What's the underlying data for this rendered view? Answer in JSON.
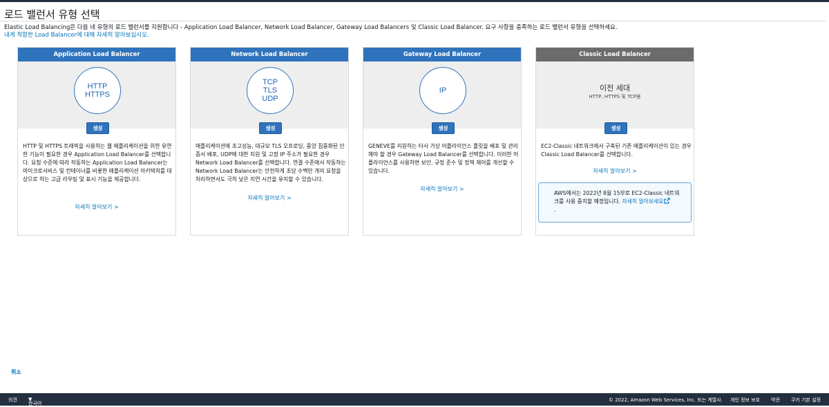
{
  "page": {
    "title": "로드 밸런서 유형 선택",
    "intro_line1": "Elastic Load Balancing은 다음 네 유형의 로드 밸런서를 지원합니다 - Application Load Balancer, Network Load Balancer, Gateway Load Balancers 및 Classic Load Balancer. 요구 사항을 충족하는 로드 밸런서 유형을 선택하세요.",
    "intro_link": "내게 적합한 Load Balancer에 대해 자세히 알아보십시오."
  },
  "cards": [
    {
      "header": "Application Load Balancer",
      "protocol_lines": [
        "HTTP",
        "HTTPS"
      ],
      "create_label": "생성",
      "description": "HTTP 및 HTTPS 트래픽을 사용하는 웹 애플리케이션을 위한 유연한 기능이 필요한 경우 Application Load Balancer를 선택합니다. 요청 수준에 따라 작동하는 Application Load Balancer는 마이크로서비스 및 컨테이너를 비롯한 애플리케이션 아키텍처를 대상으로 하는 고급 라우팅 및 표시 기능을 제공합니다.",
      "learn_more": "자세히 알아보기 >"
    },
    {
      "header": "Network Load Balancer",
      "protocol_lines": [
        "TCP",
        "TLS",
        "UDP"
      ],
      "create_label": "생성",
      "description": "애플리케이션에 초고성능, 대규모 TLS 오프로딩, 중앙 집중화된 인증서 배포, UDP에 대한 지원 및 고정 IP 주소가 필요한 경우 Network Load Balancer를 선택합니다. 연결 수준에서 작동하는 Network Load Balancer는 안전하게 초당 수백만 개의 요청을 처리하면서도 극히 낮은 지연 시간을 유지할 수 있습니다.",
      "learn_more": "자세히 알아보기 >"
    },
    {
      "header": "Gateway Load Balancer",
      "protocol_lines": [
        "IP"
      ],
      "create_label": "생성",
      "description": "GENEVE를 지원하는 타사 가상 어플라이언스 플릿을 배포 및 관리해야 할 경우 Gateway Load Balancer를 선택합니다. 이러한 어플라이언스를 사용하면 보안, 규정 준수 및 정책 제어를 개선할 수 있습니다.",
      "learn_more": "자세히 알아보기 >"
    },
    {
      "header": "Classic Load Balancer",
      "legacy_title": "이전 세대",
      "legacy_sub": "HTTP, HTTPS 및 TCP용",
      "create_label": "생성",
      "description": "EC2-Classic 네트워크에서 구축된 기존 애플리케이션이 있는 경우 Classic Load Balancer를 선택합니다.",
      "learn_more": "자세히 알아보기 >",
      "notice_text": "AWS에서는 2022년 8월 15부로 EC2-Classic 네트워크를 사용 중지할 예정입니다.",
      "notice_link": "자세히 알아보세요",
      "notice_end": "."
    }
  ],
  "cancel_label": "취소",
  "footer": {
    "feedback": "의견",
    "language": "한국어",
    "copyright": "© 2022, Amazon Web Services, Inc. 또는 계열사.",
    "privacy": "개인 정보 보호",
    "terms": "약관",
    "cookies": "쿠키 기본 설정"
  },
  "colors": {
    "header_blue": "#2f73bc",
    "header_gray": "#6b6b6b",
    "link": "#0073bb",
    "footer_bg": "#232f3e"
  }
}
